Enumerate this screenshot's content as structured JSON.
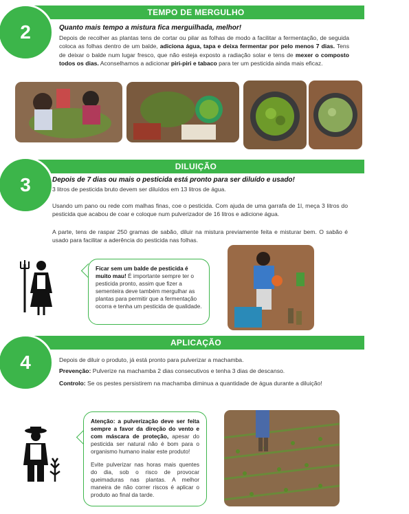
{
  "sections": [
    {
      "number": "2",
      "title": "TEMPO DE MERGULHO",
      "subtitle": "Quanto mais tempo a mistura fica merguilhada, melhor!",
      "text": [
        {
          "t": "Depois de recolher as plantas tens de cortar ou pilar as folhas de modo a facilitar a fermentação, de seguida coloca as folhas dentro de um balde, ",
          "b": false
        },
        {
          "t": "adiciona água, tapa e deixa fermentar por pelo menos 7 dias.",
          "b": true
        },
        {
          "t": " Tens de deixar o balde num lugar fresco, que não esteja exposto a radiação solar e tens de ",
          "b": false
        },
        {
          "t": "mexer o composto todos os dias.",
          "b": true
        },
        {
          "t": " Aconselhamos a adicionar ",
          "b": false
        },
        {
          "t": "piri-piri e tabaco",
          "b": true
        },
        {
          "t": " para ter um pesticida ainda mais eficaz.",
          "b": false
        }
      ]
    },
    {
      "number": "3",
      "title": "DILUIÇÃO",
      "subtitle": "Depois de 7 dias ou mais o pesticida está pronto para ser diluído e usado!",
      "line1": "3 litros de pesticida bruto devem ser diluídos em 13 litros de água.",
      "para2": "Usando um pano ou rede com malhas finas, coe o pesticida. Com ajuda de uma garrafa de 1l, meça 3 litros do pesticida que acabou de coar e coloque num pulverizador de 16 litros e adicione água.",
      "para3": "A parte, tens de raspar 250 gramas de sabão, diluir na mistura previamente feita e misturar bem. O sabão é usado para facilitar a aderência do pesticida  nas folhas.",
      "bubble_bold": "Ficar sem um balde de pesticida é muito mau!",
      "bubble_text": " É importante sempre ter o pesticida pronto, assim que fizer a sementeira deve também mergulhar as plantas para permitir que a fermentação ocorra e tenha um pesticida de qualidade."
    },
    {
      "number": "4",
      "title": "APLICAÇÃO",
      "line1": "Depois de diluir o produto, já está pronto para pulverizar a machamba.",
      "prev_label": "Prevenção:",
      "prev_text": " Pulverize na machamba 2 dias consecutivos e tenha 3 dias de descanso.",
      "ctrl_label": "Controlo:",
      "ctrl_text": " Se os pestes persistirem na machamba diminua a quantidade de água durante a diluição!",
      "bubble_bold": "Atenção: a pulverização deve ser feita sempre a favor da direção do vento e com máscara de proteção,",
      "bubble_text": " apesar do pesticida ser natural não é bom para o organismo humano inalar este produto!",
      "bubble_text2": "Evite pulverizar nas horas mais quentes do dia, sob o risco de provocar queimaduras nas plantas. A melhor maneira de não correr riscos é aplicar o produto ao final da tarde."
    }
  ],
  "colors": {
    "accent": "#3cb54a"
  }
}
